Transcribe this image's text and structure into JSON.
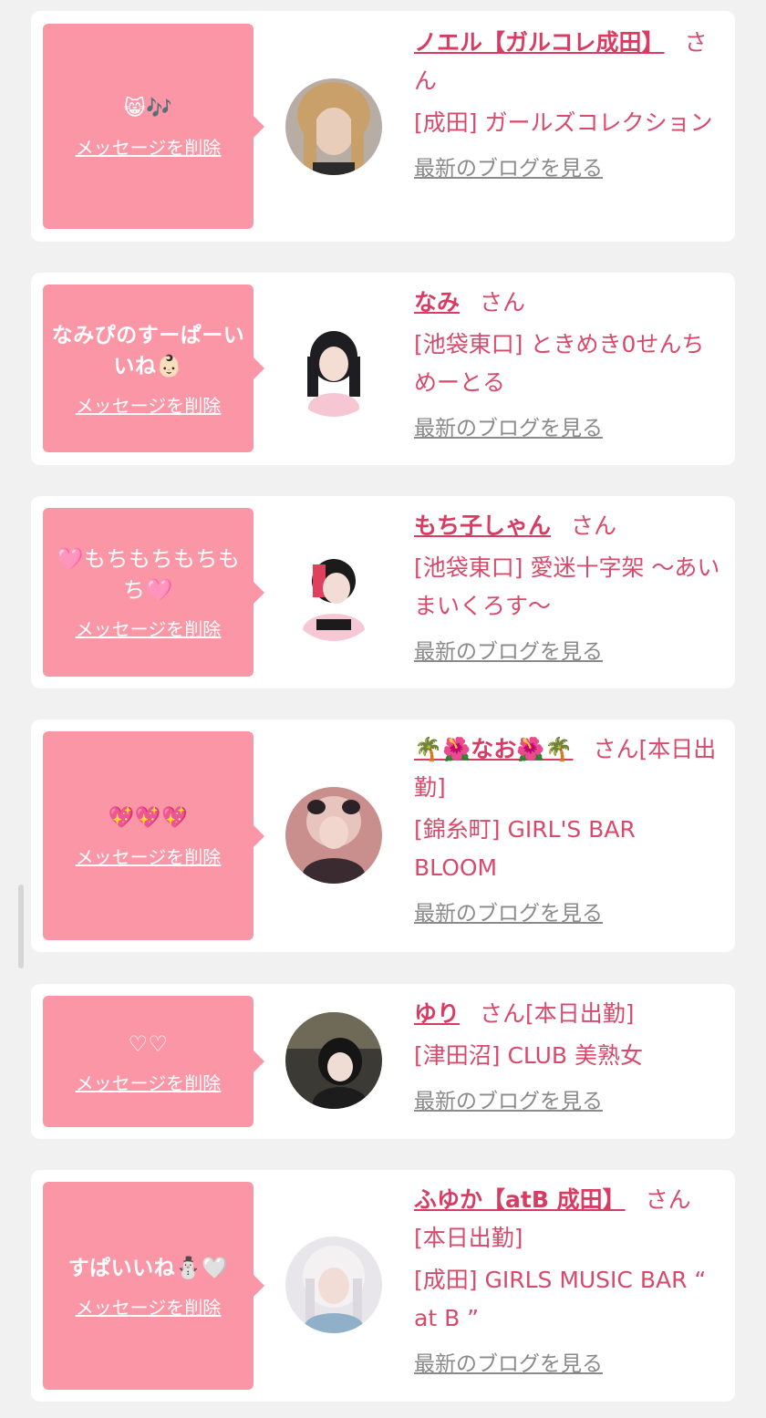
{
  "common": {
    "delete_label": "メッセージを削除",
    "blog_label": "最新のブログを見る",
    "honorific": "さん"
  },
  "entries": [
    {
      "message": "😸🎶",
      "name": "ノエル【ガルコレ成田】",
      "after_name": "さん",
      "shop": "[成田] ガールズコレクション"
    },
    {
      "message": "なみぴのすーぱーいいね👶🏻",
      "name": "なみ",
      "after_name": "さん",
      "shop": "[池袋東口] ときめき0せんちめーとる"
    },
    {
      "message": "🩷ｍｏｃｈｉｍｏｃｈｉ🩷",
      "message_display": "🩷もちもちもちもち🩷",
      "name": "もち子しゃん",
      "after_name": "さん",
      "shop": "[池袋東口] 愛迷十字架 〜あいまいくろす〜"
    },
    {
      "message": "💖💖💖",
      "name": "🌴🌺なお🌺🌴",
      "after_name": "さん[本日出勤]",
      "shop": "[錦糸町] GIRL'S BAR BLOOM"
    },
    {
      "message": "♡♡",
      "name": "ゆり",
      "after_name": "さん[本日出勤]",
      "shop": "[津田沼] CLUB 美熟女"
    },
    {
      "message": "すぱいいね⛄🤍",
      "name": "ふゆか【atB 成田】",
      "after_name": "さん[本日出勤]",
      "shop": "[成田] GIRLS MUSIC BAR “ at B ”"
    }
  ],
  "colors": {
    "bubble": "#fb96a7",
    "name": "#d83c62",
    "text": "#d84a6b",
    "link_gray": "#8a8a8a",
    "background": "#f1f1f1"
  }
}
